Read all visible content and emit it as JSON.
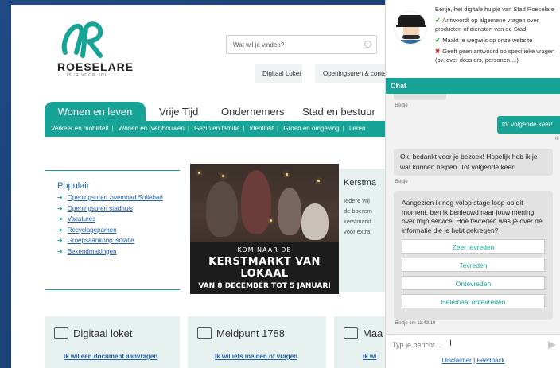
{
  "site": {
    "logo_name": "ROESELARE",
    "logo_tagline": "IS 'R VOOR JOU",
    "search_placeholder": "Wat wil je vinden?",
    "top_buttons": [
      "Digitaal Loket",
      "Openingsuren & conta"
    ]
  },
  "nav": {
    "tabs": [
      "Wonen en leven",
      "Vrije Tijd",
      "Ondernemers",
      "Stad en bestuur"
    ],
    "subnav": [
      "Verkeer en mobiliteit",
      "Wonen en (ver)bouwen",
      "Gezin en familie",
      "Identiteit",
      "Groen en omgeving",
      "Leren"
    ]
  },
  "populair": {
    "title": "Populair",
    "links": [
      "Openingsuren zwembad Sollebad",
      "Openingsuren stadhuis",
      "Vacatures",
      "Recyclageparken",
      "Groepsaankoop isolatie",
      "Bekendmakingen"
    ]
  },
  "kerstmarkt": {
    "banner_line1": "KOM NAAR DE",
    "banner_line2": "KERSTMARKT VAN LOKAAL",
    "banner_line3": "VAN 8 DECEMBER TOT 5 JANUARI",
    "panel_title": "Kerstma",
    "panel_lines": [
      "Iedere vrij",
      "de boerem",
      "kerstmarkt",
      "voor extra"
    ]
  },
  "cards": [
    {
      "title": "Digitaal loket",
      "link": "Ik wil een document aanvragen"
    },
    {
      "title": "Meldpunt 1788",
      "link": "Ik wil iets melden of vragen"
    },
    {
      "title": "Maa",
      "link": "Ik wi"
    }
  ],
  "chat": {
    "intro_lines": [
      {
        "mark": "",
        "text": "Bertje, het digitale hulpje van Stad Roeselare"
      },
      {
        "mark": "✔",
        "text": "Antwoordt op algemene vragen over producten of diensten van de Stad"
      },
      {
        "mark": "✔",
        "text": "Maakt je wegwijs op onze website"
      },
      {
        "mark": "✖",
        "text": "Geeft geen antwoord op specifieke vragen (bv. over dossiers, personen,...)"
      }
    ],
    "header": "Chat",
    "sender_bot": "Bertje",
    "user_message": "tot volgende keer!",
    "user_mark": "K",
    "bot_message_1": "Ok, bedankt voor je bezoek! Hopelijk heb ik je wat kunnen helpen. Tot volgende keer!",
    "bot_question": "Aangezien ik nog volop stage loop op dit moment, ben ik benieuwd naar jouw mening over mijn service. Hoe tevreden was je over de informatie die je hebt gekregen?",
    "options": [
      "Zeer tevreden",
      "Tevreden",
      "Ontevreden",
      "Helemaal ontevreden"
    ],
    "timestamp": "Bertje om 11:43:10",
    "input_placeholder": "Typ je bericht...",
    "footer_disclaimer": "Disclaimer",
    "footer_sep": "|",
    "footer_feedback": "Feedback"
  },
  "colors": {
    "accent": "#17a396",
    "link": "#1f5fa5",
    "background": "#1a3d6e"
  }
}
